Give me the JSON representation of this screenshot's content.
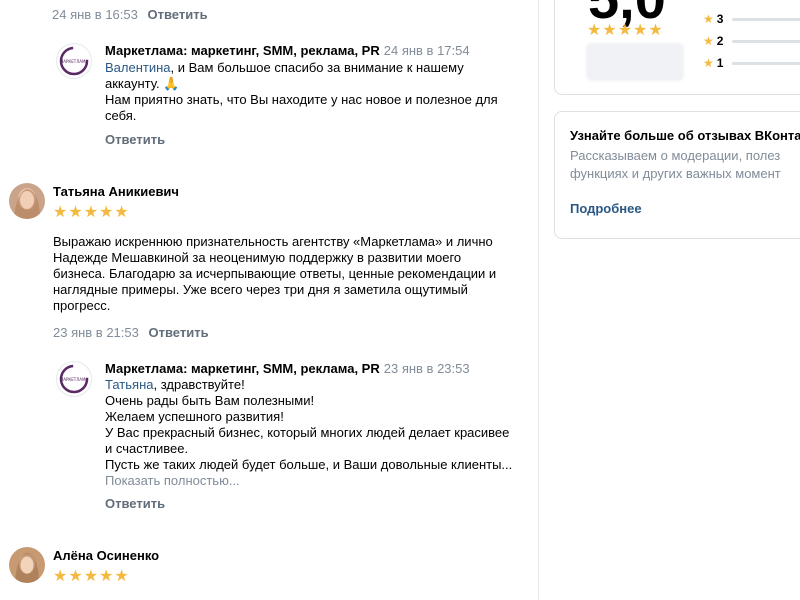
{
  "colors": {
    "star": "#f4b940",
    "link": "#2a5885",
    "meta": "#818c99",
    "divider": "#e7e8ec"
  },
  "reply_label": "Ответить",
  "thread1": {
    "review_meta": {
      "date": "24 янв в 16:53"
    },
    "response": {
      "author": "Маркетлама: маркетинг, SMM, реклама, PR",
      "date": "24 янв в 17:54",
      "mention": "Валентина",
      "line1_rest": ", и Вам большое спасибо за внимание к нашему",
      "line2": "аккаунту. 🙏",
      "line3": "Нам приятно знать, что Вы находите у нас новое и полезное для",
      "line4": "себя."
    }
  },
  "review2": {
    "author": "Татьяна Аникиевич",
    "rating": 5,
    "lines": [
      "Выражаю искреннюю признательность агентству «Маркетлама» и лично",
      "Надежде Мешавкиной за неоценимую поддержку в развитии моего",
      "бизнеса. Благодарю за исчерпывающие ответы, ценные рекомендации и",
      "наглядные примеры. Уже всего через три дня я заметила ощутимый",
      "прогресс."
    ],
    "date": "23 янв в 21:53",
    "response": {
      "author": "Маркетлама: маркетинг, SMM, реклама, PR",
      "date": "23 янв в 23:53",
      "mention": "Татьяна",
      "line1_rest": ", здравствуйте!",
      "lines": [
        "Очень рады быть Вам полезными!",
        "Желаем успешного развития!",
        "У Вас прекрасный бизнес, который многих людей делает красивее",
        "и счастливее.",
        "Пусть же таких людей будет больше, и Ваши довольные клиенты..."
      ],
      "show_more": "Показать полностью..."
    }
  },
  "review3": {
    "author": "Алёна Осиненко",
    "rating": 5
  },
  "rating_card": {
    "score": "5,0",
    "stars": 5,
    "rows": [
      {
        "label": "3",
        "fraction": 0
      },
      {
        "label": "2",
        "fraction": 0
      },
      {
        "label": "1",
        "fraction": 0
      }
    ]
  },
  "info_card": {
    "title": "Узнайте больше об отзывах ВКонта",
    "text1": "Рассказываем о модерации, полез",
    "text2": "функциях и других важных момент",
    "link": "Подробнее"
  }
}
